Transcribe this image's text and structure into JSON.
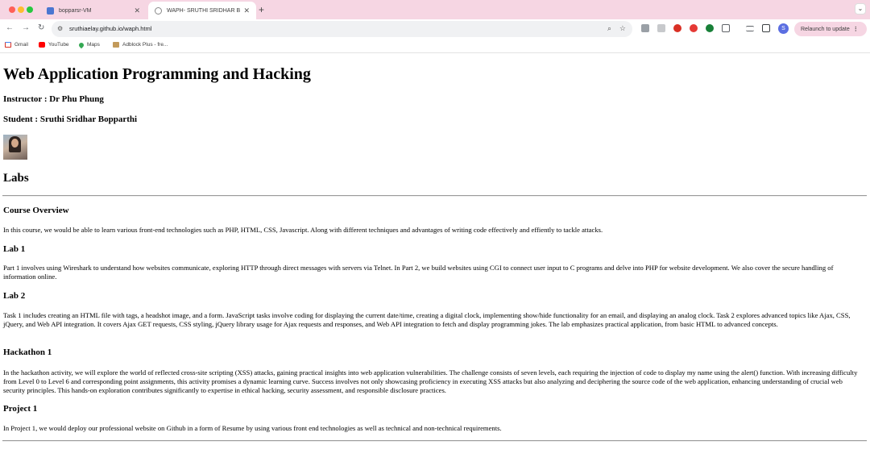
{
  "browser": {
    "tabs": [
      {
        "title": "bopparsr-VM",
        "active": false
      },
      {
        "title": "WAPH- SRUTHI SRIDHAR BO",
        "active": true
      }
    ],
    "new_tab_label": "+",
    "url": "sruthiaelay.github.io/waph.html",
    "relaunch_label": "Relaunch to update",
    "profile_initial": "S",
    "bookmarks": [
      "Gmail",
      "YouTube",
      "Maps",
      "Adblock Plus - fre..."
    ]
  },
  "page": {
    "title": "Web Application Programming and Hacking",
    "instructor": "Instructor : Dr Phu Phung",
    "student": "Student : Sruthi Sridhar Bopparthi",
    "labs_heading": "Labs",
    "sections": [
      {
        "heading": "Course Overview",
        "text": "In this course, we would be able to learn various front-end technologies such as PHP, HTML, CSS, Javascript. Along with different techniques and advantages of writing code effectively and effiently to tackle attacks."
      },
      {
        "heading": "Lab 1",
        "text": "Part 1 involves using Wireshark to understand how websites communicate, exploring HTTP through direct messages with servers via Telnet. In Part 2, we build websites using CGI to connect user input to C programs and delve into PHP for website development. We also cover the secure handling of information online."
      },
      {
        "heading": "Lab 2",
        "text": "Task 1 includes creating an HTML file with tags, a headshot image, and a form. JavaScript tasks involve coding for displaying the current date/time, creating a digital clock, implementing show/hide functionality for an email, and displaying an analog clock. Task 2 explores advanced topics like Ajax, CSS, jQuery, and Web API integration. It covers Ajax GET requests, CSS styling, jQuery library usage for Ajax requests and responses, and Web API integration to fetch and display programming jokes. The lab emphasizes practical application, from basic HTML to advanced concepts."
      },
      {
        "heading": "Hackathon 1",
        "text": "In the hackathon activity, we will explore the world of reflected cross-site scripting (XSS) attacks, gaining practical insights into web application vulnerabilities. The challenge consists of seven levels, each requiring the injection of code to display my name using the alert() function. With increasing difficulty from Level 0 to Level 6 and corresponding point assignments, this activity promises a dynamic learning curve. Success involves not only showcasing proficiency in executing XSS attacks but also analyzing and deciphering the source code of the web application, enhancing understanding of crucial web security principles. This hands-on exploration contributes significantly to expertise in ethical hacking, security assessment, and responsible disclosure practices."
      },
      {
        "heading": "Project 1",
        "text": "In Project 1, we would deploy our professional website on Github in a form of Resume by using various front end technologies as well as technical and non-technical requirements."
      }
    ]
  }
}
